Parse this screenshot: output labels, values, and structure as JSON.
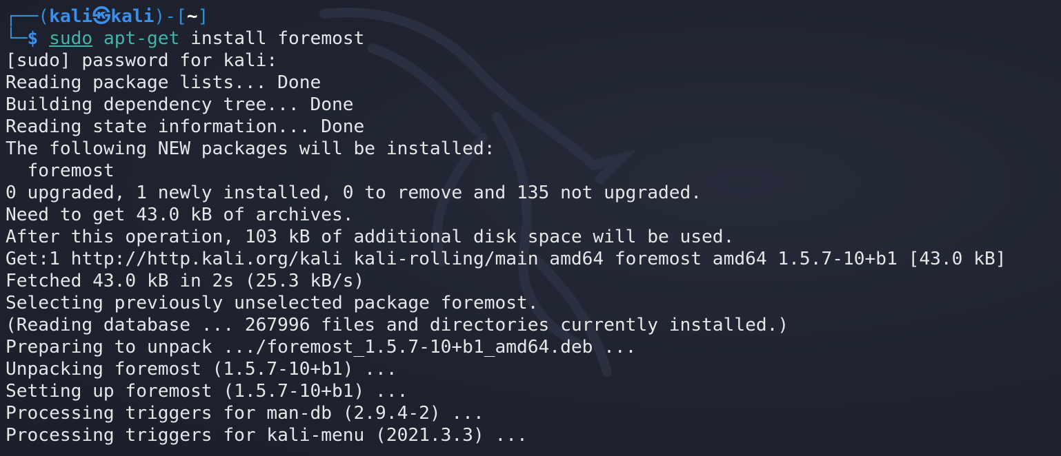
{
  "prompt": {
    "frame_open": "┌──(",
    "user": "kali",
    "at_symbol": "㉿",
    "host": "kali",
    "frame_mid": ")-[",
    "path": "~",
    "frame_close": "]",
    "frame_corner": "└─",
    "symbol": "$",
    "command_sudo": "sudo",
    "command_bin": "apt-get",
    "command_args": "install foremost"
  },
  "output_lines": [
    "[sudo] password for kali:",
    "Reading package lists... Done",
    "Building dependency tree... Done",
    "Reading state information... Done",
    "The following NEW packages will be installed:",
    "  foremost",
    "0 upgraded, 1 newly installed, 0 to remove and 135 not upgraded.",
    "Need to get 43.0 kB of archives.",
    "After this operation, 103 kB of additional disk space will be used.",
    "Get:1 http://http.kali.org/kali kali-rolling/main amd64 foremost amd64 1.5.7-10+b1 [43.0 kB]",
    "Fetched 43.0 kB in 2s (25.3 kB/s)",
    "Selecting previously unselected package foremost.",
    "(Reading database ... 267996 files and directories currently installed.)",
    "Preparing to unpack .../foremost_1.5.7-10+b1_amd64.deb ...",
    "Unpacking foremost (1.5.7-10+b1) ...",
    "Setting up foremost (1.5.7-10+b1) ...",
    "Processing triggers for man-db (2.9.4-2) ...",
    "Processing triggers for kali-menu (2021.3.3) ..."
  ],
  "colors": {
    "background": "#1f2330",
    "text": "#e6e6e6",
    "prompt_blue": "#3b8eea",
    "command_teal": "#3fb6a8"
  }
}
